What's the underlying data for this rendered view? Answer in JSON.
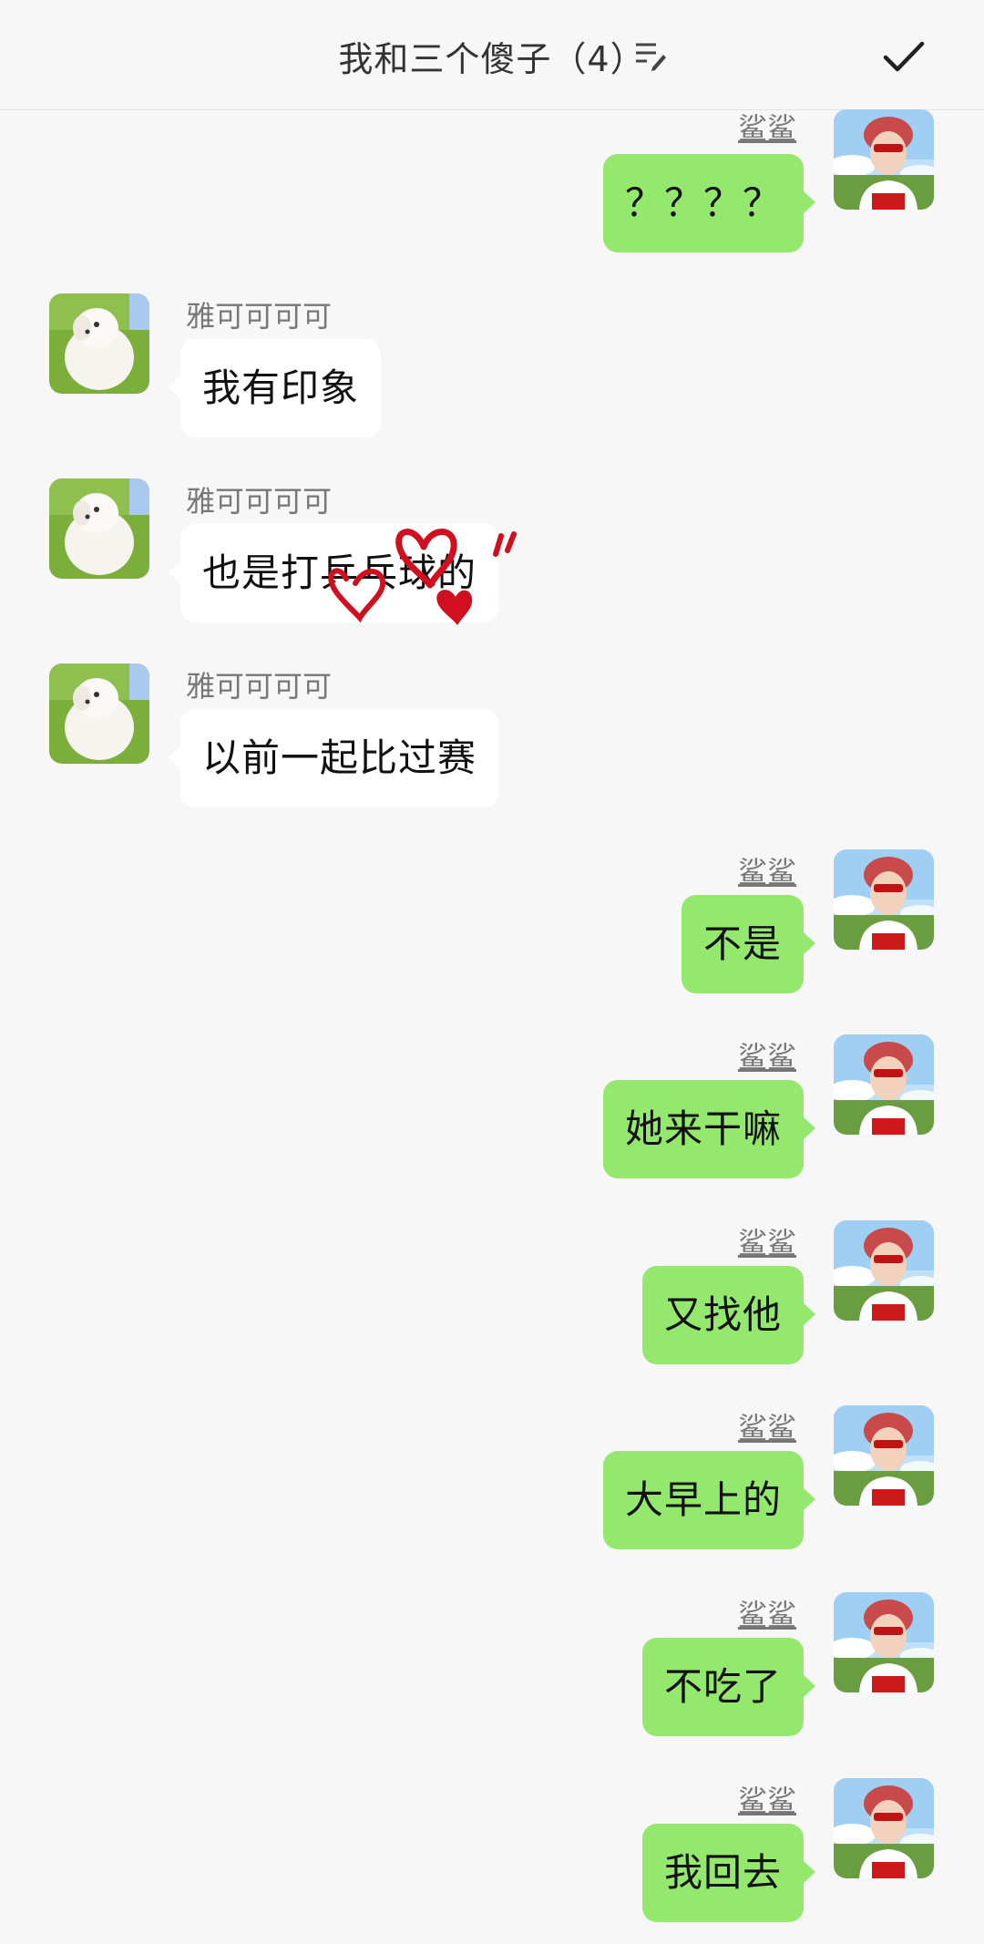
{
  "header": {
    "title": "我和三个傻子（4）",
    "edit_icon": "edit-list-icon",
    "confirm_icon": "checkmark-icon"
  },
  "colors": {
    "background": "#f7f7f7",
    "my_bubble": "#95e86e",
    "other_bubble": "#ffffff",
    "heart_sticker": "#d0101e"
  },
  "messages": [
    {
      "side": "me",
      "sender": "鲨鲨",
      "text": "？？？？",
      "avatar": "girl-red-hat-avatar"
    },
    {
      "side": "other",
      "sender": "雅可可可可",
      "text": "我有印象",
      "avatar": "white-dog-avatar"
    },
    {
      "side": "other",
      "sender": "雅可可可可",
      "text": "也是打乒乓球的",
      "avatar": "white-dog-avatar"
    },
    {
      "side": "other",
      "sender": "雅可可可可",
      "text": "以前一起比过赛",
      "avatar": "white-dog-avatar"
    },
    {
      "side": "me",
      "sender": "鲨鲨",
      "text": "不是",
      "avatar": "girl-red-hat-avatar"
    },
    {
      "side": "me",
      "sender": "鲨鲨",
      "text": "她来干嘛",
      "avatar": "girl-red-hat-avatar"
    },
    {
      "side": "me",
      "sender": "鲨鲨",
      "text": "又找他",
      "avatar": "girl-red-hat-avatar"
    },
    {
      "side": "me",
      "sender": "鲨鲨",
      "text": "大早上的",
      "avatar": "girl-red-hat-avatar"
    },
    {
      "side": "me",
      "sender": "鲨鲨",
      "text": "不吃了",
      "avatar": "girl-red-hat-avatar"
    },
    {
      "side": "me",
      "sender": "鲨鲨",
      "text": "我回去",
      "avatar": "girl-red-hat-avatar"
    }
  ],
  "stickers": {
    "hearts": "heart-doodle-sticker"
  }
}
